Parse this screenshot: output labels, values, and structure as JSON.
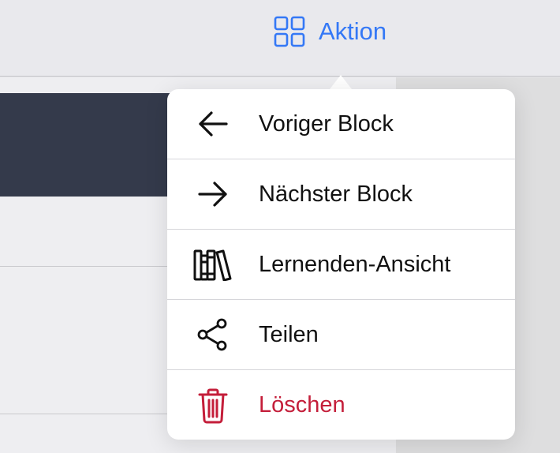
{
  "toolbar": {
    "action_label": "Aktion",
    "action_icon": "grid-icon",
    "accent_color": "#3478f6"
  },
  "menu": {
    "items": [
      {
        "label": "Voriger Block",
        "icon": "arrow-left-icon"
      },
      {
        "label": "Nächster Block",
        "icon": "arrow-right-icon"
      },
      {
        "label": "Lernenden-Ansicht",
        "icon": "books-icon"
      },
      {
        "label": "Teilen",
        "icon": "share-icon"
      },
      {
        "label": "Löschen",
        "icon": "trash-icon",
        "color": "#c41e3a"
      }
    ]
  }
}
